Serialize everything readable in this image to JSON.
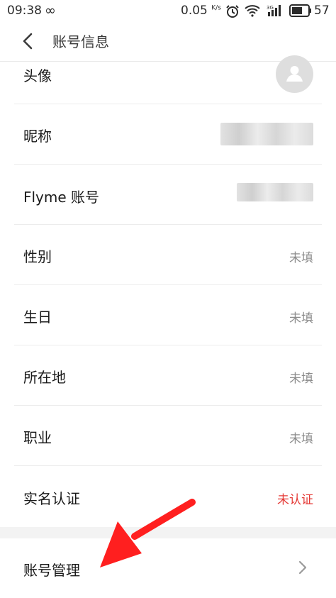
{
  "status_bar": {
    "time": "09:38",
    "infinity_glyph": "∞",
    "net_speed": "0.05",
    "net_unit": "K/s",
    "battery": "57",
    "icons": [
      "infinity-icon",
      "alarm-icon",
      "wifi-icon",
      "signal-3g-icon",
      "battery-icon"
    ]
  },
  "header": {
    "title": "账号信息",
    "back_icon": "chevron-left-icon"
  },
  "rows": [
    {
      "label": "头像",
      "value": ""
    },
    {
      "label": "昵称",
      "value": ""
    },
    {
      "label": "Flyme 账号",
      "value": ""
    },
    {
      "label": "性别",
      "value": "未填"
    },
    {
      "label": "生日",
      "value": "未填"
    },
    {
      "label": "所在地",
      "value": "未填"
    },
    {
      "label": "职业",
      "value": "未填"
    },
    {
      "label": "实名认证",
      "value": "未认证"
    }
  ],
  "account_manage": {
    "label": "账号管理",
    "chevron_icon": "chevron-right-icon"
  },
  "colors": {
    "accent_red": "#e53935",
    "value_gray": "#8c8c8c",
    "annotation_arrow": "#ff1f1f"
  }
}
